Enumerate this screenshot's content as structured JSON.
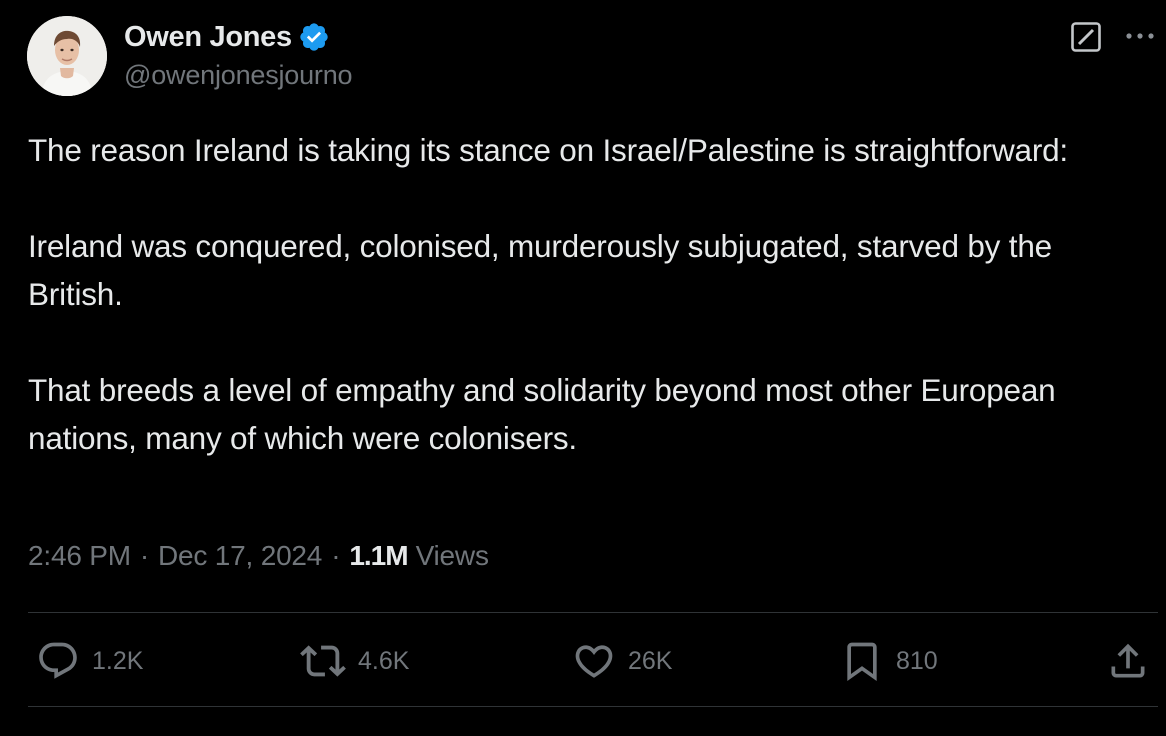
{
  "author": {
    "display_name": "Owen Jones",
    "handle": "@owenjonesjourno",
    "verified_color": "#1d9bf0"
  },
  "tweet": {
    "paragraphs": [
      "The reason Ireland is taking its stance on Israel/Palestine is straightforward:",
      "Ireland was conquered, colonised, murderously subjugated, starved by the British.",
      "That breeds a level of empathy and solidarity beyond most other European nations, many of which were colonisers."
    ]
  },
  "meta": {
    "time": "2:46 PM",
    "separator": "·",
    "date": "Dec 17, 2024",
    "views_count": "1.1M",
    "views_label": "Views"
  },
  "actions": {
    "replies": "1.2K",
    "reposts": "4.6K",
    "likes": "26K",
    "bookmarks": "810"
  },
  "icons": {
    "header": [
      "grok-icon",
      "more-icon",
      "verified-badge-icon"
    ],
    "actions": [
      "reply-icon",
      "repost-icon",
      "like-icon",
      "bookmark-icon",
      "share-icon"
    ]
  },
  "colors": {
    "background": "#000000",
    "text": "#e7e9ea",
    "secondary_text": "#71767b",
    "divider": "#2f3336",
    "accent": "#1d9bf0"
  }
}
